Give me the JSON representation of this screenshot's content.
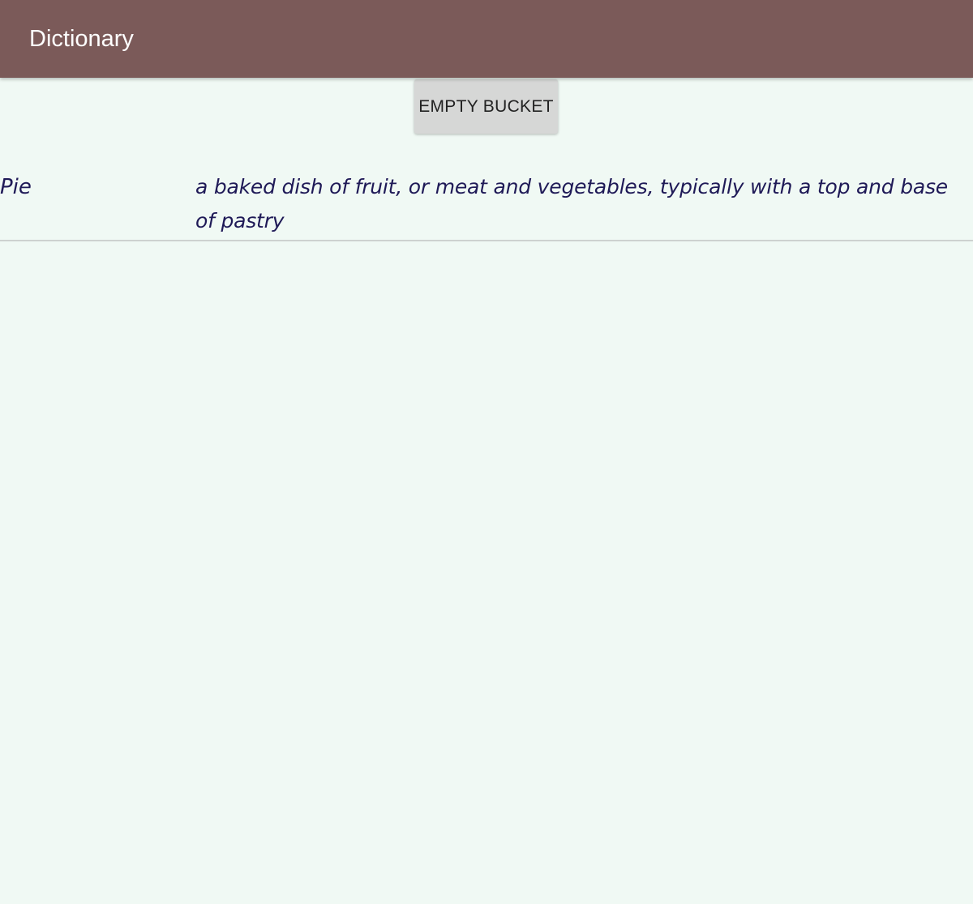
{
  "app_bar": {
    "title": "Dictionary",
    "background_color": "#7b5a59"
  },
  "actions": {
    "empty_bucket_label": "EMPTY BUCKET"
  },
  "entries": [
    {
      "word": "Pie",
      "definition": "a baked dish of fruit, or meat and vegetables, typically with a top and base of pastry"
    }
  ],
  "colors": {
    "background": "#f0f9f4",
    "entry_text": "#1f1a57",
    "button_background": "#d6d7d6"
  }
}
